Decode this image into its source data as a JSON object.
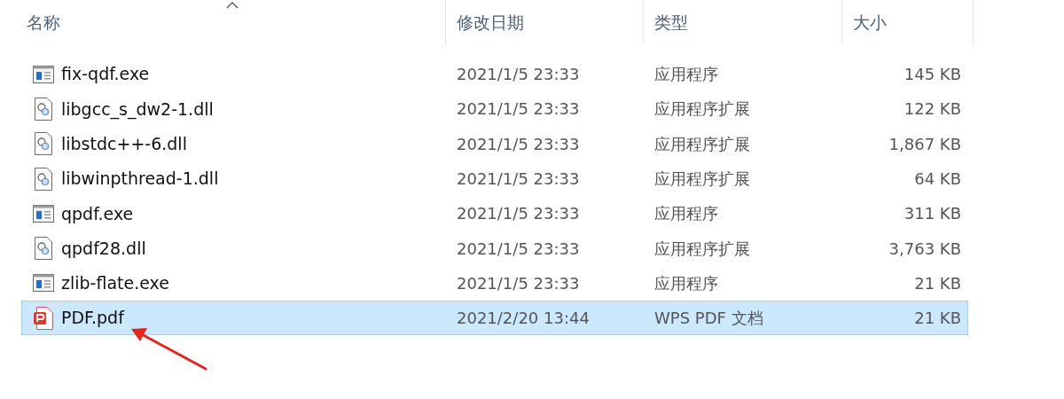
{
  "columns": [
    {
      "label": "名称",
      "sorted": true
    },
    {
      "label": "修改日期",
      "sorted": false
    },
    {
      "label": "类型",
      "sorted": false
    },
    {
      "label": "大小",
      "sorted": false
    }
  ],
  "files": [
    {
      "kind": "exe",
      "name": "fix-qdf.exe",
      "modified": "2021/1/5 23:33",
      "type": "应用程序",
      "size": "145 KB",
      "selected": false
    },
    {
      "kind": "dll",
      "name": "libgcc_s_dw2-1.dll",
      "modified": "2021/1/5 23:33",
      "type": "应用程序扩展",
      "size": "122 KB",
      "selected": false
    },
    {
      "kind": "dll",
      "name": "libstdc++-6.dll",
      "modified": "2021/1/5 23:33",
      "type": "应用程序扩展",
      "size": "1,867 KB",
      "selected": false
    },
    {
      "kind": "dll",
      "name": "libwinpthread-1.dll",
      "modified": "2021/1/5 23:33",
      "type": "应用程序扩展",
      "size": "64 KB",
      "selected": false
    },
    {
      "kind": "exe",
      "name": "qpdf.exe",
      "modified": "2021/1/5 23:33",
      "type": "应用程序",
      "size": "311 KB",
      "selected": false
    },
    {
      "kind": "dll",
      "name": "qpdf28.dll",
      "modified": "2021/1/5 23:33",
      "type": "应用程序扩展",
      "size": "3,763 KB",
      "selected": false
    },
    {
      "kind": "exe",
      "name": "zlib-flate.exe",
      "modified": "2021/1/5 23:33",
      "type": "应用程序",
      "size": "21 KB",
      "selected": false
    },
    {
      "kind": "pdf",
      "name": "PDF.pdf",
      "modified": "2021/2/20 13:44",
      "type": "WPS PDF 文档",
      "size": "21 KB",
      "selected": true
    }
  ]
}
